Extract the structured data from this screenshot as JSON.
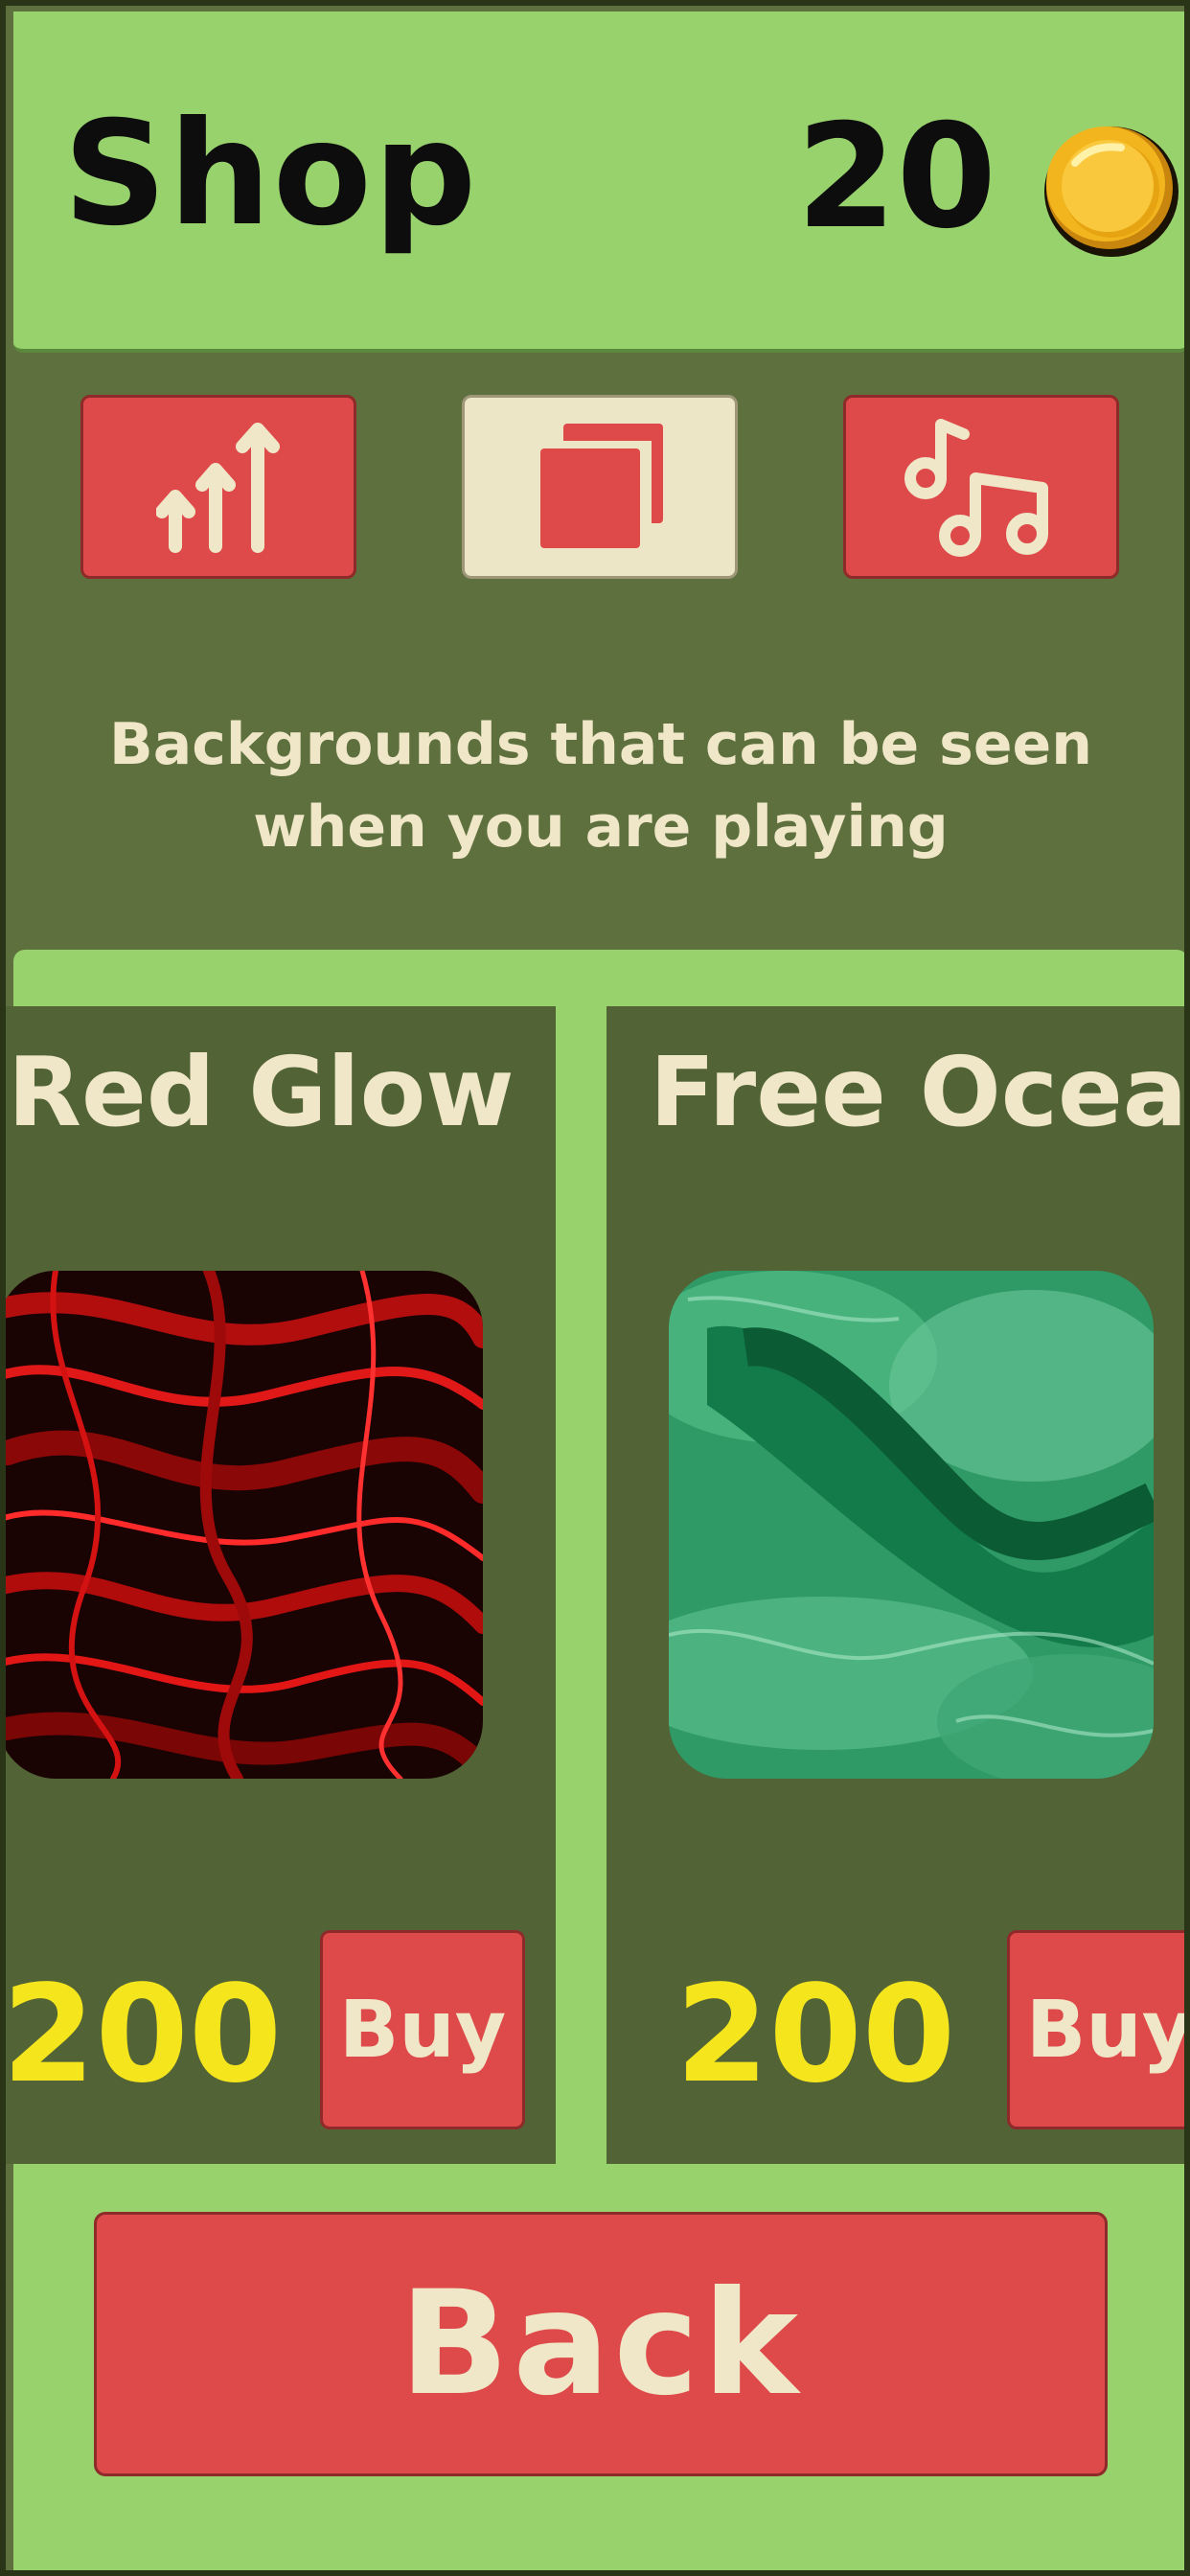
{
  "header": {
    "title": "Shop",
    "coins": "20",
    "coin_icon": "gold-coin-icon"
  },
  "tabs": [
    {
      "icon": "upgrades-arrows-icon",
      "active": false
    },
    {
      "icon": "backgrounds-layers-icon",
      "active": true
    },
    {
      "icon": "music-notes-icon",
      "active": false
    }
  ],
  "description": {
    "line1": "Backgrounds that can be seen",
    "line2": "when you are playing"
  },
  "items": [
    {
      "name": "Red Glow",
      "price": "200",
      "buy_label": "Buy"
    },
    {
      "name": "Free Ocean",
      "price": "200",
      "buy_label": "Buy"
    }
  ],
  "back_label": "Back",
  "colors": {
    "header_bg": "#98d26d",
    "panel_bg": "#5e703e",
    "card_bg": "#526336",
    "button_red": "#de4a4a",
    "cream": "#efe7c8",
    "price_yellow": "#f4e51c"
  }
}
